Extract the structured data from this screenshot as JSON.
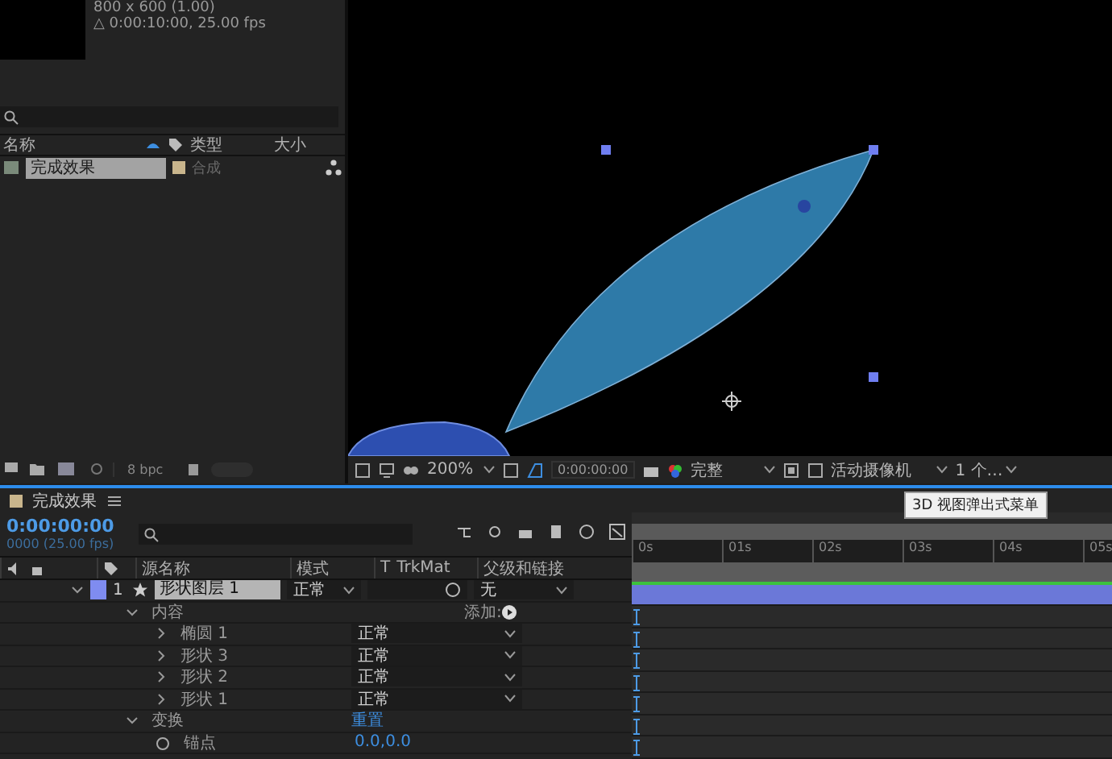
{
  "project": {
    "comp_info": [
      "800 x 600 (1.00)",
      "△ 0:00:10:00, 25.00 fps"
    ],
    "columns": [
      "名称",
      "类型",
      "大小"
    ],
    "items": [
      {
        "name": "完成效果",
        "type": "合成",
        "selected": true
      }
    ],
    "bit_depth": "8 bpc"
  },
  "viewer": {
    "zoom": "200%",
    "timecode": "0:00:00:00",
    "resolution": "完整",
    "camera": "活动摄像机",
    "views": "1 个…",
    "tooltip": "3D 视图弹出式菜单"
  },
  "timeline": {
    "tab": "完成效果",
    "timecode": "0:00:00:00",
    "frame_info": "0000 (25.00 fps)",
    "columns": {
      "source_name": "源名称",
      "mode": "模式",
      "t": "T",
      "trkmat": "TrkMat",
      "parent": "父级和链接"
    },
    "layers": [
      {
        "index": "1",
        "name": "形状图层 1",
        "mode": "正常",
        "parent": "无",
        "selected": true,
        "expanded": true,
        "children": [
          {
            "name": "内容",
            "expanded": true,
            "action": "添加:",
            "children": [
              {
                "name": "椭圆 1",
                "expanded": false,
                "mode": "正常"
              },
              {
                "name": "形状 3",
                "expanded": false,
                "mode": "正常"
              },
              {
                "name": "形状 2",
                "expanded": false,
                "mode": "正常"
              },
              {
                "name": "形状 1",
                "expanded": false,
                "mode": "正常"
              }
            ]
          },
          {
            "name": "变换",
            "expanded": true,
            "action": "重置",
            "children": [
              {
                "name": "锚点",
                "value": "0.0,0.0"
              }
            ]
          }
        ]
      }
    ],
    "ruler": [
      "0s",
      "01s",
      "02s",
      "03s",
      "04s",
      "05s"
    ]
  }
}
